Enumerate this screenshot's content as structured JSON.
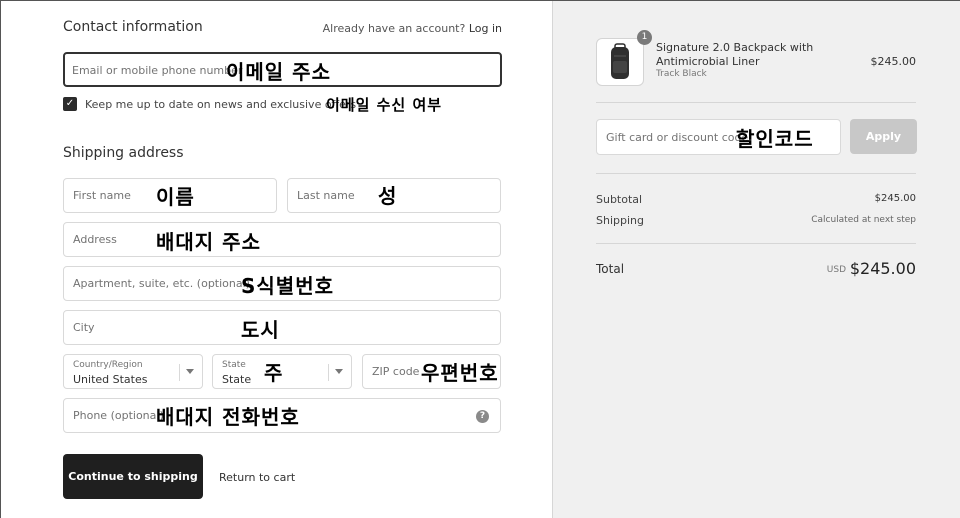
{
  "contact": {
    "heading": "Contact information",
    "login_prompt": "Already have an account?",
    "login_link": "Log in",
    "email_placeholder": "Email or mobile phone number",
    "email_annotation": "이메일 주소",
    "newsletter_label": "Keep me up to date on news and exclusive offers",
    "newsletter_annotation": "이메일 수신 여부",
    "newsletter_checked": true
  },
  "shipping": {
    "heading": "Shipping address",
    "first_name_placeholder": "First name",
    "first_name_annotation": "이름",
    "last_name_placeholder": "Last name",
    "last_name_annotation": "성",
    "address_placeholder": "Address",
    "address_annotation": "배대지 주소",
    "apartment_placeholder": "Apartment, suite, etc. (optional)",
    "apartment_annotation": "S식별번호",
    "city_placeholder": "City",
    "city_annotation": "도시",
    "country_label": "Country/Region",
    "country_value": "United States",
    "state_label": "State",
    "state_value": "State",
    "state_annotation": "주",
    "zip_placeholder": "ZIP code",
    "zip_annotation": "우편번호",
    "phone_placeholder": "Phone (optional)",
    "phone_annotation": "배대지 전화번호",
    "continue_label": "Continue to shipping",
    "return_label": "Return to cart"
  },
  "summary": {
    "item": {
      "quantity": "1",
      "name": "Signature 2.0 Backpack with Antimicrobial Liner",
      "variant": "Track Black",
      "price": "$245.00"
    },
    "discount_placeholder": "Gift card or discount code",
    "discount_annotation": "할인코드",
    "apply_label": "Apply",
    "subtotal_label": "Subtotal",
    "subtotal_value": "$245.00",
    "shipping_label": "Shipping",
    "shipping_value": "Calculated at next step",
    "total_label": "Total",
    "total_currency": "USD",
    "total_value": "$245.00"
  }
}
